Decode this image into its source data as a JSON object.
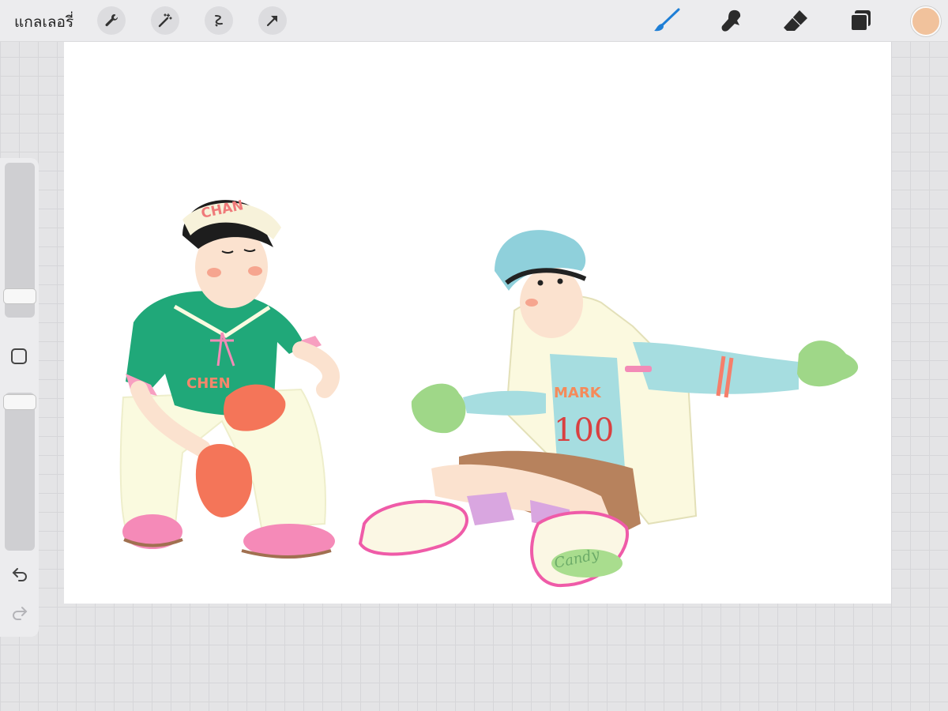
{
  "topbar": {
    "gallery_label": "แกลเลอรี่",
    "left_tools": [
      "wrench-icon",
      "magic-wand-icon",
      "selection-icon",
      "transform-arrow-icon"
    ],
    "right_tools": [
      "brush-icon",
      "smudge-icon",
      "eraser-icon",
      "layers-icon"
    ],
    "active_tool": "brush-icon",
    "current_color": "#f1c29c",
    "accent_color": "#1f7fd6"
  },
  "sidebar": {
    "controls": [
      "brush-size-slider",
      "modify-button",
      "opacity-slider",
      "undo-icon",
      "redo-icon"
    ]
  },
  "canvas": {
    "background": "#ffffff",
    "artwork_text": {
      "left_cap": "CHAN",
      "left_shirt": "CHEN",
      "right_shirt_top": "MARK",
      "right_shirt_number": "100",
      "right_shoe": "Candy"
    }
  }
}
